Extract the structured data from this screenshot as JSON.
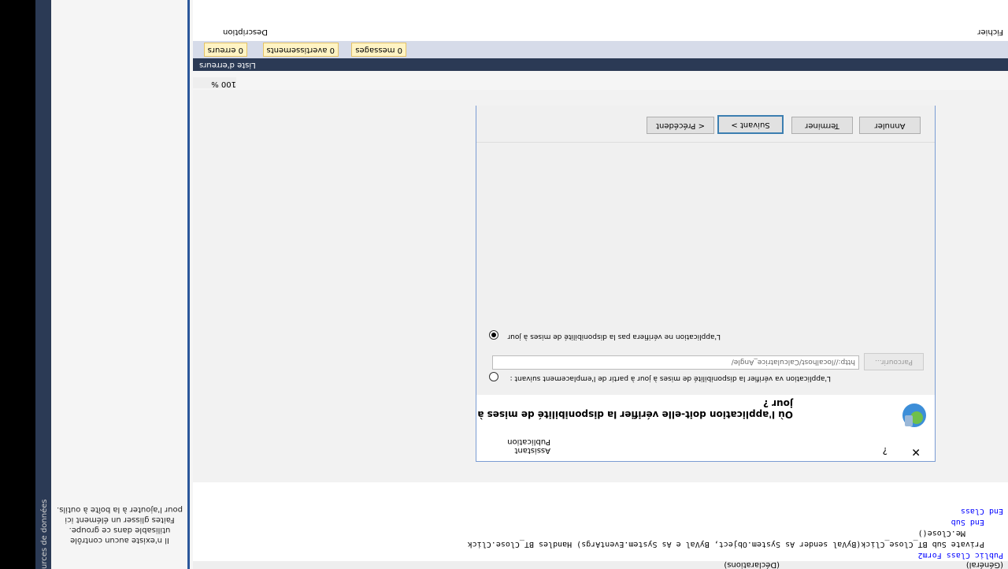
{
  "navbar": {
    "left": "(Déclarations)",
    "right": "(Général)"
  },
  "code_lines": [
    "Public Class Form2",
    "    Private Sub BT_Close_Click(ByVal sender As System.Object, ByVal e As System.EventArgs) Handles BT_Close.Click",
    "        Me.Close()",
    "    End Sub",
    "End Class"
  ],
  "zoom": "100 %",
  "error_list": {
    "title": "Liste d'erreurs",
    "errors": "0 erreurs",
    "warnings": "0 avertissements",
    "messages": "0 messages",
    "columns": {
      "description": "Description",
      "file": "Fichier"
    }
  },
  "toolbox": {
    "tab_label": "urces de données",
    "message": "Il n'existe aucun contrôle utilisable dans ce groupe. Faites glisser un élément ici pour l'ajouter à la boîte à outils."
  },
  "dialog": {
    "title": "Assistant Publication",
    "help": "?",
    "close": "✕",
    "heading": "Où l'application doit-elle vérifier la disponibilité de mises à jour ?",
    "option_check": "L'application va vérifier la disponibilité de mises à jour à partir de l'emplacement suivant :",
    "url": "http://localhost/Calculatrice_Angle/",
    "browse": "Parcourir...",
    "option_no_check": "L'application ne vérifiera pas la disponibilité de mises à jour",
    "buttons": {
      "prev": "< Précédent",
      "next": "Suivant >",
      "finish": "Terminer",
      "cancel": "Annuler"
    }
  },
  "colors": {
    "accent": "#2b579a",
    "titlebar": "#2b3a55"
  }
}
